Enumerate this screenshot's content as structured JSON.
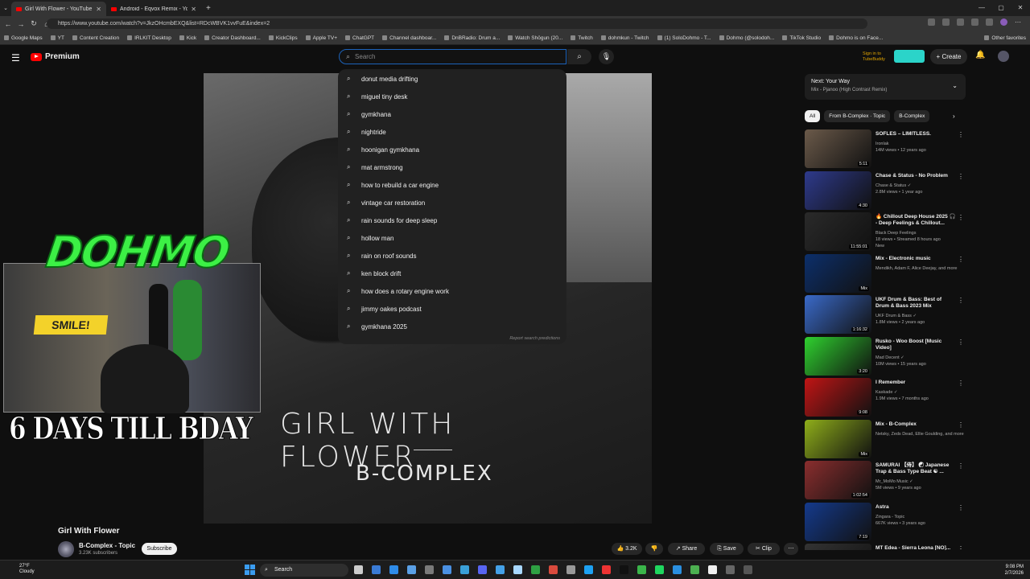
{
  "browser": {
    "tabs": [
      {
        "title": "Girl With Flower - YouTube",
        "active": true
      },
      {
        "title": "Android - Eqvox Remix - YouTube Music",
        "active": false
      }
    ],
    "url": "https://www.youtube.com/watch?v=JkzOHcmbEXQ&list=RDcWBVK1vvFuE&index=2",
    "bookmarks": [
      "Google Maps",
      "YT",
      "Content Creation",
      "IRLKIT Desktop",
      "Kick",
      "Creator Dashboard...",
      "KickClips",
      "Apple TV+",
      "ChatGPT",
      "Channel dashboar...",
      "DnBRadio: Drum a...",
      "Watch Shōgun (20...",
      "Twitch",
      "dohmkun - Twitch",
      "(1) SoloDohmo - T...",
      "Dohmo (@solodoh...",
      "TikTok Studio",
      "Dohmo is on Face...",
      "Other favorites"
    ]
  },
  "header": {
    "brand": "Premium",
    "search_placeholder": "Search",
    "signin_text": "Sign in to TubeBuddy",
    "create_label": "+ Create"
  },
  "search_suggestions": [
    "donut media drifting",
    "miguel tiny desk",
    "gymkhana",
    "nightride",
    "hoonigan gymkhana",
    "mat armstrong",
    "how to rebuild a car engine",
    "vintage car restoration",
    "rain sounds for deep sleep",
    "hollow man",
    "rain on roof sounds",
    "ken block drift",
    "how does a rotary engine work",
    "jimmy oakes podcast",
    "gymkhana 2025"
  ],
  "report_predictions": "Report search predictions",
  "video": {
    "overlay_title": "GIRL WITH FLOWER",
    "overlay_artist": "B-COMPLEX",
    "title": "Girl With Flower",
    "channel": "B-Complex - Topic",
    "subscribers": "3.23K subscribers",
    "subscribe_label": "Subscribe",
    "likes": "3.2K",
    "share_label": "Share",
    "save_label": "Save",
    "clip_label": "Clip"
  },
  "stream_overlay": {
    "logo_text": "DOHMO",
    "countdown": "6 DAYS TILL BDAY",
    "sign_text": "SMILE!"
  },
  "up_next": {
    "label": "Next: Your Way",
    "subtitle": "Mix - Pjanoo (High Contrast Remix)"
  },
  "chips": [
    "All",
    "From B-Complex · Topic",
    "B-Complex"
  ],
  "recommendations": [
    {
      "title": "SOFLES – LIMITLESS.",
      "line1": "Ironlak",
      "line2": "14M views • 12 years ago",
      "duration": "5:11",
      "color": "#6b5a4a"
    },
    {
      "title": "Chase & Status - No Problem",
      "line1": "Chase & Status ✓",
      "line2": "2.8M views • 1 year ago",
      "duration": "4:30",
      "color": "#2e3a8c"
    },
    {
      "title": "🔥 Chillout Deep House 2025 🎧 - Deep Feelings & Chillout...",
      "line1": "Black Deep Feelings",
      "line2": "18 views • Streamed 8 hours ago",
      "line3": "New",
      "duration": "11:55:01",
      "color": "#2a2a2a"
    },
    {
      "title": "Mix - Electronic music",
      "line1": "Mendikh, Adam F, Alice Deejay, and more",
      "line2": "",
      "duration": "Mix",
      "color": "#0c2f6b"
    },
    {
      "title": "UKF Drum & Bass: Best of Drum & Bass 2023 Mix",
      "line1": "UKF Drum & Bass ✓",
      "line2": "1.8M views • 2 years ago",
      "duration": "1:16:32",
      "color": "#3a6ac9"
    },
    {
      "title": "Rusko - Woo Boost [Music Video]",
      "line1": "Mad Decent ✓",
      "line2": "10M views • 15 years ago",
      "duration": "3:20",
      "color": "#2fd12f"
    },
    {
      "title": "I Remember",
      "line1": "Kaskade ✓",
      "line2": "1.9M views • 7 months ago",
      "duration": "9:08",
      "color": "#c01515"
    },
    {
      "title": "Mix - B-Complex",
      "line1": "Netsky, Zeds Dead, Ellie Goulding, and more",
      "line2": "",
      "duration": "Mix",
      "color": "#8fae1a"
    },
    {
      "title": "SAMURAI 【侍】 ☯ Japanese Trap & Bass Type Beat ☯ ...",
      "line1": "Mr_MoMo Music ✓",
      "line2": "5M views • 9 years ago",
      "duration": "1:02:54",
      "color": "#8a2e2e"
    },
    {
      "title": "Astra",
      "line1": "Zingara - Topic",
      "line2": "667K views • 3 years ago",
      "duration": "7:19",
      "color": "#143a8c"
    },
    {
      "title": "MT Edea - Sierra Leona [NO]...",
      "line1": "",
      "line2": "",
      "duration": "",
      "color": "#333"
    }
  ],
  "taskbar": {
    "weather_temp": "27°F",
    "weather_desc": "Cloudy",
    "search_label": "Search",
    "time": "9:08 PM",
    "date": "2/7/2026"
  }
}
